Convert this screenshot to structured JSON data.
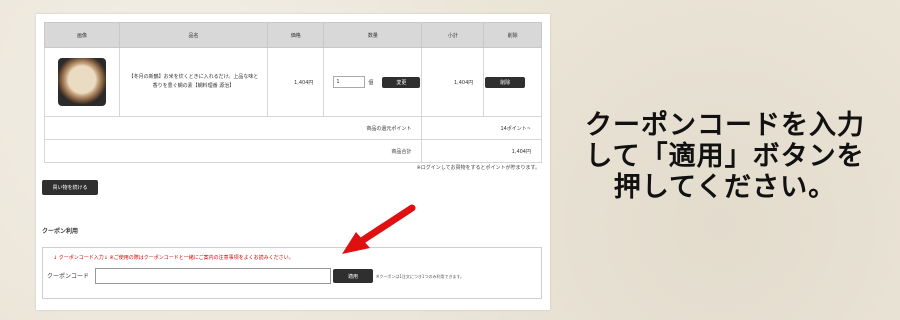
{
  "cart": {
    "headers": {
      "product": "画像",
      "name": "品名",
      "price": "価格",
      "quantity": "数量",
      "subtotal": "小計",
      "delete": "削除"
    },
    "item": {
      "name": "【冬月の新鶴】お米を炊くときに入れるだけ。上品な味と香りを豊ぐ鯛の素【鯛料理番 源治】",
      "price": "1,404円",
      "quantity": "1",
      "unit": "個",
      "change_label": "変更",
      "subtotal": "1,404円",
      "delete_label": "削除"
    },
    "points_label": "商品の還元ポイント",
    "points_value": "14ポイント~",
    "total_label": "商品合計",
    "total_value": "1,404円"
  },
  "login_note": "※ログインしてお買物をするとポイントが貯まります。",
  "continue_label": "買い物を続ける",
  "coupon": {
    "heading": "クーポン利用",
    "note": "↓ クーポンコード入力↓ ※ご使用の際はクーポンコードと一緒にご案内の注意事項をよくお読みください。",
    "label": "クーポンコード",
    "input_value": "",
    "apply_label": "適用",
    "apply_note": "※クーポンは1注文につき1つのみ利用できます。"
  },
  "instruction": {
    "line1": "クーポンコードを入力",
    "line2": "して「適用」ボタンを",
    "line3": "押してください。"
  },
  "colors": {
    "arrow": "#e01010",
    "button": "#2f2f2f",
    "header_bg": "#d8d8d8"
  }
}
